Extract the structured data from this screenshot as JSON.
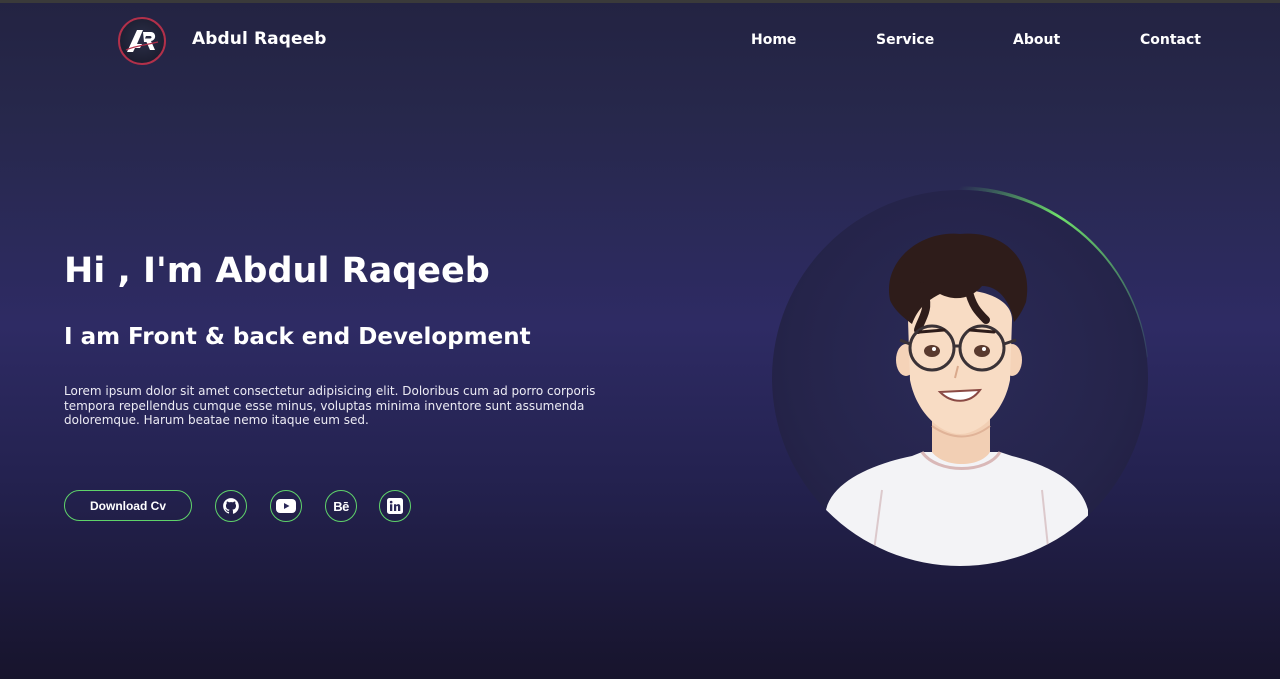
{
  "header": {
    "logo_text": "AR",
    "brand": "Abdul Raqeeb",
    "nav": [
      {
        "label": "Home"
      },
      {
        "label": "Service"
      },
      {
        "label": "About"
      },
      {
        "label": "Contact"
      }
    ]
  },
  "hero": {
    "title": "Hi , I'm Abdul Raqeeb",
    "subtitle": "I am Front & back end Development",
    "description": "Lorem ipsum dolor sit amet consectetur adipisicing elit. Doloribus cum ad porro corporis tempora repellendus cumque esse minus, voluptas minima inventore sunt assumenda doloremque. Harum beatae nemo itaque eum sed.",
    "download_label": "Download Cv",
    "socials": [
      {
        "icon": "github-icon"
      },
      {
        "icon": "youtube-icon"
      },
      {
        "icon": "behance-icon",
        "text": "Bē"
      },
      {
        "icon": "linkedin-icon"
      }
    ]
  },
  "avatar": {
    "icon": "avatar-illustration"
  },
  "colors": {
    "accent_green": "#5fd36a",
    "logo_ring": "#b2304a",
    "bg_mid": "#2e2b64"
  }
}
